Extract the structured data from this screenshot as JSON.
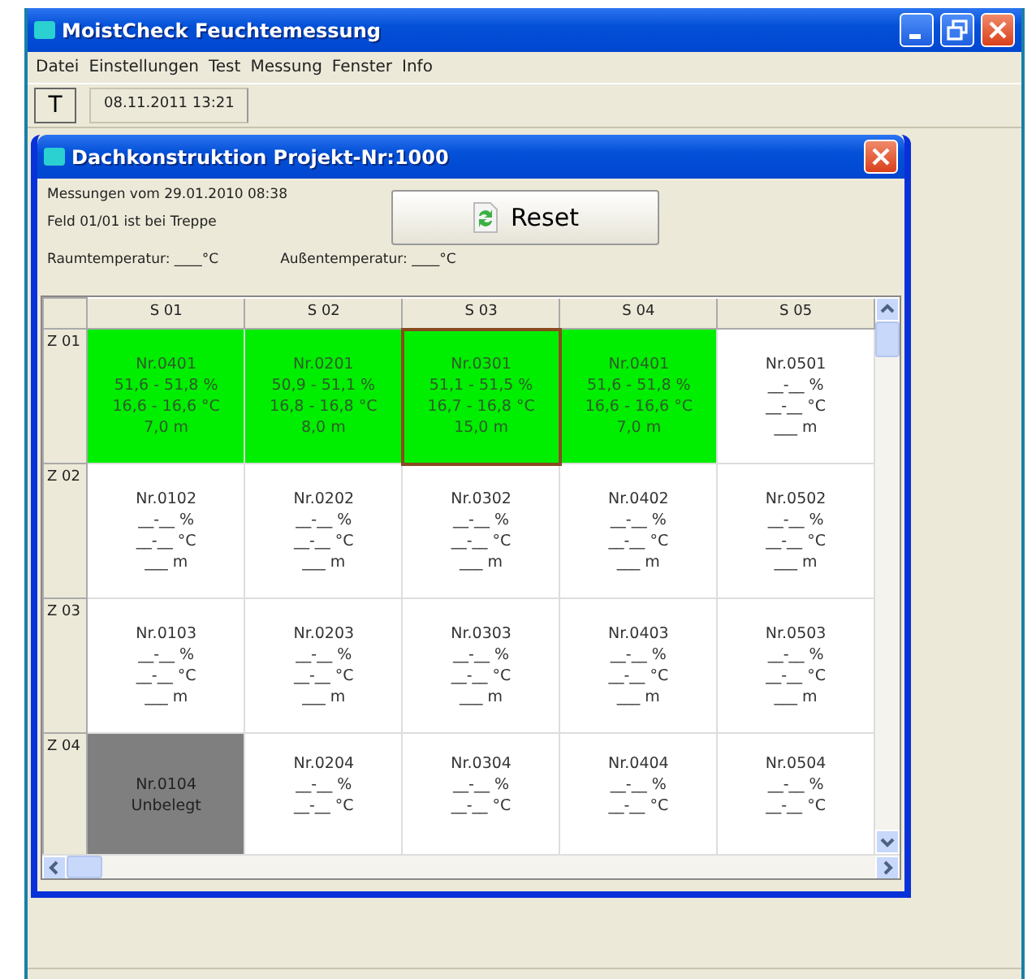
{
  "app": {
    "title": "MoistCheck Feuchtemessung"
  },
  "menu": [
    "Datei",
    "Einstellungen",
    "Test",
    "Messung",
    "Fenster",
    "Info"
  ],
  "toolbar": {
    "button": "T",
    "datetime": "08.11.2011 13:21"
  },
  "child_window": {
    "title": "Dachkonstruktion Projekt-Nr:1000",
    "info": [
      "Messungen vom 29.01.2010 08:38",
      "Feld 01/01 ist bei Treppe"
    ],
    "room_temp": "Raumtemperatur: ____°C",
    "outside_temp": "Außentemperatur: ____°C",
    "reset_button": "Reset",
    "grid": {
      "columns": [
        "S 01",
        "S 02",
        "S 03",
        "S 04",
        "S 05"
      ],
      "rows": [
        {
          "label": "Z 01",
          "cells": [
            {
              "kind": "measured",
              "selected": false,
              "lines": [
                "Nr.0401",
                "51,6 - 51,8 %",
                "16,6 - 16,6 °C",
                "7,0 m"
              ]
            },
            {
              "kind": "measured",
              "selected": false,
              "lines": [
                "Nr.0201",
                "50,9 - 51,1 %",
                "16,8 - 16,8 °C",
                "8,0 m"
              ]
            },
            {
              "kind": "measured",
              "selected": true,
              "lines": [
                "Nr.0301",
                "51,1 - 51,5 %",
                "16,7 - 16,8 °C",
                "15,0 m"
              ]
            },
            {
              "kind": "measured",
              "selected": false,
              "lines": [
                "Nr.0401",
                "51,6 - 51,8 %",
                "16,6 - 16,6 °C",
                "7,0 m"
              ]
            },
            {
              "kind": "empty",
              "selected": false,
              "lines": [
                "Nr.0501",
                "__-__ %",
                "__-__ °C",
                "___ m"
              ]
            }
          ]
        },
        {
          "label": "Z 02",
          "cells": [
            {
              "kind": "empty",
              "selected": false,
              "lines": [
                "Nr.0102",
                "__-__ %",
                "__-__ °C",
                "___ m"
              ]
            },
            {
              "kind": "empty",
              "selected": false,
              "lines": [
                "Nr.0202",
                "__-__ %",
                "__-__ °C",
                "___ m"
              ]
            },
            {
              "kind": "empty",
              "selected": false,
              "lines": [
                "Nr.0302",
                "__-__ %",
                "__-__ °C",
                "___ m"
              ]
            },
            {
              "kind": "empty",
              "selected": false,
              "lines": [
                "Nr.0402",
                "__-__ %",
                "__-__ °C",
                "___ m"
              ]
            },
            {
              "kind": "empty",
              "selected": false,
              "lines": [
                "Nr.0502",
                "__-__ %",
                "__-__ °C",
                "___ m"
              ]
            }
          ]
        },
        {
          "label": "Z 03",
          "cells": [
            {
              "kind": "empty",
              "selected": false,
              "lines": [
                "Nr.0103",
                "__-__ %",
                "__-__ °C",
                "___ m"
              ]
            },
            {
              "kind": "empty",
              "selected": false,
              "lines": [
                "Nr.0203",
                "__-__ %",
                "__-__ °C",
                "___ m"
              ]
            },
            {
              "kind": "empty",
              "selected": false,
              "lines": [
                "Nr.0303",
                "__-__ %",
                "__-__ °C",
                "___ m"
              ]
            },
            {
              "kind": "empty",
              "selected": false,
              "lines": [
                "Nr.0403",
                "__-__ %",
                "__-__ °C",
                "___ m"
              ]
            },
            {
              "kind": "empty",
              "selected": false,
              "lines": [
                "Nr.0503",
                "__-__ %",
                "__-__ °C",
                "___ m"
              ]
            }
          ]
        },
        {
          "label": "Z 04",
          "cells": [
            {
              "kind": "unused",
              "selected": false,
              "lines": [
                "Nr.0104",
                "Unbelegt"
              ]
            },
            {
              "kind": "empty",
              "selected": false,
              "lines": [
                "Nr.0204",
                "__-__ %",
                "__-__ °C"
              ]
            },
            {
              "kind": "empty",
              "selected": false,
              "lines": [
                "Nr.0304",
                "__-__ %",
                "__-__ °C"
              ]
            },
            {
              "kind": "empty",
              "selected": false,
              "lines": [
                "Nr.0404",
                "__-__ %",
                "__-__ °C"
              ]
            },
            {
              "kind": "empty",
              "selected": false,
              "lines": [
                "Nr.0504",
                "__-__ %",
                "__-__ °C"
              ]
            }
          ]
        }
      ]
    }
  }
}
